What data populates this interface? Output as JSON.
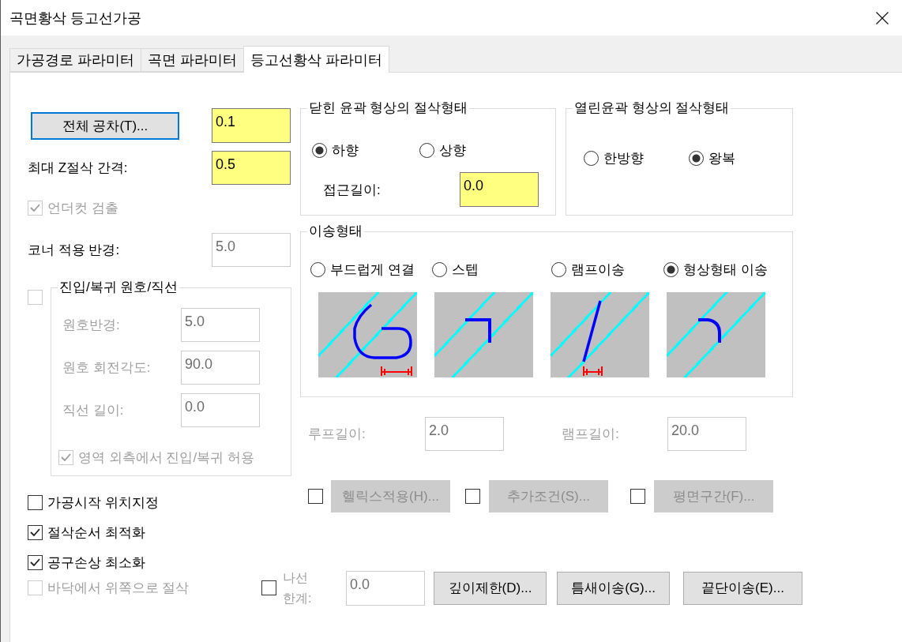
{
  "window": {
    "title": "곡면황삭 등고선가공"
  },
  "tabs": [
    {
      "label": "가공경로 파라미터",
      "selected": false
    },
    {
      "label": "곡면 파라미터",
      "selected": false
    },
    {
      "label": "등고선황삭 파라미터",
      "selected": true
    }
  ],
  "tolerance": {
    "button": "전체 공차(T)...",
    "focused": true,
    "value": "0.1",
    "disabled": false
  },
  "max_z_step": {
    "label": "최대 Z절삭 간격:",
    "value": "0.5",
    "disabled": false
  },
  "undercut_check": {
    "label": "언더컷 검출",
    "checked": true,
    "disabled": true
  },
  "corner_radius": {
    "label": "코너 적용 반경:",
    "value": "5.0",
    "disabled": true
  },
  "entry_exit": {
    "checked": false,
    "disabled": true,
    "title": "진입/복귀 원호/직선",
    "fields": [
      {
        "label": "원호반경:",
        "value": "5.0"
      },
      {
        "label": "원호 회전각도:",
        "value": "90.0"
      },
      {
        "label": "직선 길이:",
        "value": "0.0"
      }
    ],
    "outside_check": {
      "label": "영역 외측에서 진입/복귀 허용",
      "checked": true
    }
  },
  "option_checks": [
    {
      "label": "가공시작 위치지정",
      "checked": false,
      "disabled": false
    },
    {
      "label": "절삭순서 최적화",
      "checked": true,
      "disabled": false
    },
    {
      "label": "공구손상 최소화",
      "checked": true,
      "disabled": false
    },
    {
      "label": "바닥에서 위쪽으로 절삭",
      "checked": false,
      "disabled": true
    }
  ],
  "closed_contour": {
    "title": "닫힌 윤곽 형상의 절삭형태",
    "options": [
      {
        "label": "하향",
        "selected": true
      },
      {
        "label": "상향",
        "selected": false
      }
    ],
    "approach": {
      "label": "접근길이:",
      "value": "0.0",
      "disabled": false
    }
  },
  "open_contour": {
    "title": "열린윤곽 형상의 절삭형태",
    "options": [
      {
        "label": "한방향",
        "selected": false
      },
      {
        "label": "왕복",
        "selected": true
      }
    ]
  },
  "transfer": {
    "title": "이송형태",
    "options": [
      {
        "label": "부드럽게 연결",
        "selected": false,
        "kind": "loop"
      },
      {
        "label": "스텝",
        "selected": false,
        "kind": "step"
      },
      {
        "label": "램프이송",
        "selected": false,
        "kind": "ramp"
      },
      {
        "label": "형상형태 이송",
        "selected": true,
        "kind": "arc"
      }
    ]
  },
  "lengths": [
    {
      "label": "루프길이:",
      "value": "2.0",
      "disabled": true
    },
    {
      "label": "램프길이:",
      "value": "20.0",
      "disabled": true
    }
  ],
  "extra_options": [
    {
      "checked": false,
      "button": "헬릭스적용(H)...",
      "disabled": true
    },
    {
      "checked": false,
      "button": "추가조건(S)...",
      "disabled": true
    },
    {
      "checked": false,
      "button": "평면구간(F)...",
      "disabled": true
    }
  ],
  "spiral_limit": {
    "checked": false,
    "label": "나선 한계:",
    "value": "0.0",
    "disabled": true
  },
  "action_buttons": [
    {
      "label": "깊이제한(D)..."
    },
    {
      "label": "틈새이송(G)..."
    },
    {
      "label": "끝단이송(E)..."
    }
  ]
}
